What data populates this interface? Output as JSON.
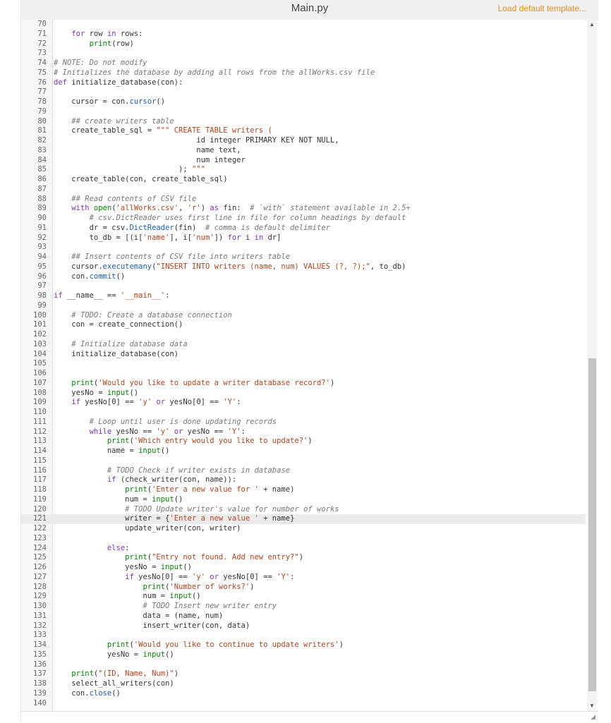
{
  "header": {
    "filename": "Main.py",
    "load_template_label": "Load default template..."
  },
  "editor": {
    "active_line": 121,
    "lines": [
      {
        "n": "70",
        "t": ""
      },
      {
        "n": "71",
        "t": "    for row in rows:"
      },
      {
        "n": "72",
        "t": "        print(row)"
      },
      {
        "n": "73",
        "t": ""
      },
      {
        "n": "74",
        "t": "# NOTE: Do not modify"
      },
      {
        "n": "75",
        "t": "# Initializes the database by adding all rows from the allWorks.csv file"
      },
      {
        "n": "76",
        "t": "def initialize_database(con):"
      },
      {
        "n": "77",
        "t": ""
      },
      {
        "n": "78",
        "t": "    cursor = con.cursor()"
      },
      {
        "n": "79",
        "t": ""
      },
      {
        "n": "80",
        "t": "    ## create writers table"
      },
      {
        "n": "81",
        "t": "    create_table_sql = \"\"\" CREATE TABLE writers ("
      },
      {
        "n": "82",
        "t": "                                id integer PRIMARY KEY NOT NULL,"
      },
      {
        "n": "83",
        "t": "                                name text,"
      },
      {
        "n": "84",
        "t": "                                num integer"
      },
      {
        "n": "85",
        "t": "                            ); \"\"\""
      },
      {
        "n": "86",
        "t": "    create_table(con, create_table_sql)"
      },
      {
        "n": "87",
        "t": ""
      },
      {
        "n": "88",
        "t": "    ## Read contents of CSV file"
      },
      {
        "n": "89",
        "t": "    with open('allWorks.csv', 'r') as fin:  # `with` statement available in 2.5+"
      },
      {
        "n": "90",
        "t": "        # csv.DictReader uses first line in file for column headings by default"
      },
      {
        "n": "91",
        "t": "        dr = csv.DictReader(fin)  # comma is default delimiter"
      },
      {
        "n": "92",
        "t": "        to_db = [(i['name'], i['num']) for i in dr]"
      },
      {
        "n": "93",
        "t": ""
      },
      {
        "n": "94",
        "t": "    ## Insert contents of CSV file into writers table"
      },
      {
        "n": "95",
        "t": "    cursor.executemany(\"INSERT INTO writers (name, num) VALUES (?, ?);\", to_db)"
      },
      {
        "n": "96",
        "t": "    con.commit()"
      },
      {
        "n": "97",
        "t": ""
      },
      {
        "n": "98",
        "t": "if __name__ == '__main__':"
      },
      {
        "n": "99",
        "t": ""
      },
      {
        "n": "100",
        "t": "    # TODO: Create a database connection"
      },
      {
        "n": "101",
        "t": "    con = create_connection()"
      },
      {
        "n": "102",
        "t": ""
      },
      {
        "n": "103",
        "t": "    # Initialize database data"
      },
      {
        "n": "104",
        "t": "    initialize_database(con)"
      },
      {
        "n": "105",
        "t": ""
      },
      {
        "n": "106",
        "t": ""
      },
      {
        "n": "107",
        "t": "    print('Would you like to update a writer database record?')"
      },
      {
        "n": "108",
        "t": "    yesNo = input()"
      },
      {
        "n": "109",
        "t": "    if yesNo[0] == 'y' or yesNo[0] == 'Y':"
      },
      {
        "n": "110",
        "t": ""
      },
      {
        "n": "111",
        "t": "        # Loop until user is done updating records"
      },
      {
        "n": "112",
        "t": "        while yesNo == 'y' or yesNo == 'Y':"
      },
      {
        "n": "113",
        "t": "            print('Which entry would you like to update?')"
      },
      {
        "n": "114",
        "t": "            name = input()"
      },
      {
        "n": "115",
        "t": ""
      },
      {
        "n": "116",
        "t": "            # TODO Check if writer exists in database"
      },
      {
        "n": "117",
        "t": "            if (check_writer(con, name)):"
      },
      {
        "n": "118",
        "t": "                print('Enter a new value for ' + name)"
      },
      {
        "n": "119",
        "t": "                num = input()"
      },
      {
        "n": "120",
        "t": "                # TODO Update writer's value for number of works"
      },
      {
        "n": "121",
        "t": "                writer = {'Enter a new value ' + name}"
      },
      {
        "n": "122",
        "t": "                update_writer(con, writer)"
      },
      {
        "n": "123",
        "t": ""
      },
      {
        "n": "124",
        "t": "            else:"
      },
      {
        "n": "125",
        "t": "                print(\"Entry not found. Add new entry?\")"
      },
      {
        "n": "126",
        "t": "                yesNo = input()"
      },
      {
        "n": "127",
        "t": "                if yesNo[0] == 'y' or yesNo[0] == 'Y':"
      },
      {
        "n": "128",
        "t": "                    print('Number of works?')"
      },
      {
        "n": "129",
        "t": "                    num = input()"
      },
      {
        "n": "130",
        "t": "                    # TODO Insert new writer entry"
      },
      {
        "n": "131",
        "t": "                    data = (name, num)"
      },
      {
        "n": "132",
        "t": "                    insert_writer(con, data)"
      },
      {
        "n": "133",
        "t": ""
      },
      {
        "n": "134",
        "t": "            print('Would you like to continue to update writers')"
      },
      {
        "n": "135",
        "t": "            yesNo = input()"
      },
      {
        "n": "136",
        "t": ""
      },
      {
        "n": "137",
        "t": "    print(\"(ID, Name, Num)\")"
      },
      {
        "n": "138",
        "t": "    select_all_writers(con)"
      },
      {
        "n": "139",
        "t": "    con.close()"
      },
      {
        "n": "140",
        "t": ""
      }
    ]
  },
  "colors": {
    "accent_link": "#e98c18",
    "active_line_bg": "#ebebeb",
    "gutter_bg": "#f7f7f7"
  },
  "icons": {
    "scroll_up": "▲",
    "scroll_down": "▼",
    "resize": "◢"
  }
}
